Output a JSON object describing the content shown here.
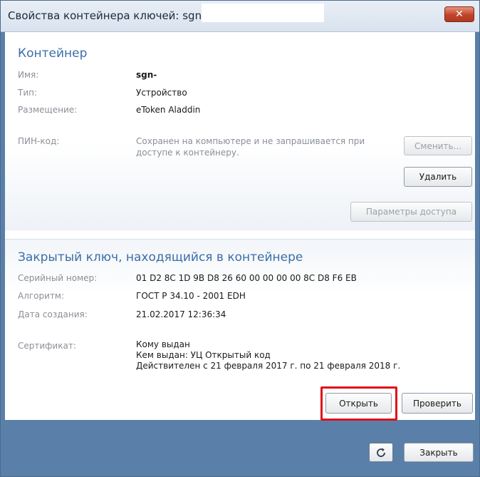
{
  "window": {
    "title": "Свойства контейнера ключей: sgn-",
    "close_glyph": "✕"
  },
  "container": {
    "heading": "Контейнер",
    "name_label": "Имя:",
    "name_value": "sgn-",
    "type_label": "Тип:",
    "type_value": "Устройство",
    "location_label": "Размещение:",
    "location_value": "eToken Aladdin",
    "pin_label": "ПИН-код:",
    "pin_text": "Сохранен на компьютере и не запрашивается при доступе к контейнеру.",
    "change_button": "Сменить...",
    "delete_button": "Удалить",
    "access_params_button": "Параметры доступа"
  },
  "private_key": {
    "heading": "Закрытый ключ, находящийся в контейнере",
    "serial_label": "Серийный номер:",
    "serial_value": "01 D2 8C 1D 9B D8 26 60 00 00 00 00 8C D8 F6 EB",
    "algorithm_label": "Алгоритм:",
    "algorithm_value": "ГОСТ Р 34.10 - 2001 EDH",
    "created_label": "Дата создания:",
    "created_value": "21.02.2017 12:36:34",
    "certificate_label": "Сертификат:",
    "issued_to": "Кому выдан:",
    "issued_by": "Кем выдан: УЦ Открытый код",
    "validity": "Действителен с 21 февраля 2017 г. по 21 февраля 2018 г.",
    "open_button": "Открыть",
    "verify_button": "Проверить"
  },
  "footer": {
    "refresh_icon": "refresh-icon",
    "close_button": "Закрыть"
  },
  "colors": {
    "accent_heading": "#3a6ea8",
    "footer_background": "#5a7fa8",
    "highlight": "#e0101a"
  }
}
